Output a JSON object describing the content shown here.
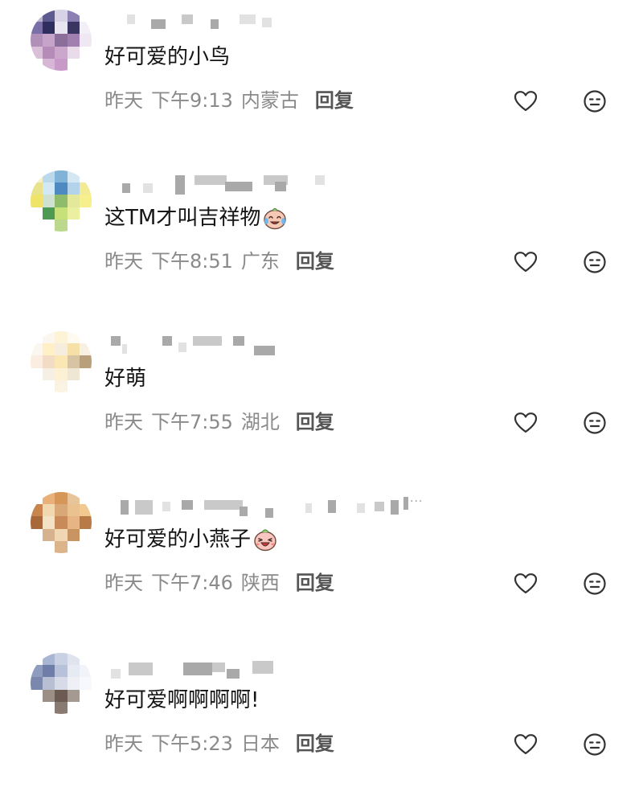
{
  "comments": [
    {
      "username_label": "",
      "text": "好可爱的小鸟",
      "date": "昨天",
      "time": "下午9:13",
      "location": "内蒙古",
      "reply_label": "回复",
      "emoji": ""
    },
    {
      "username_label": "",
      "text": "这TM才叫吉祥物",
      "date": "昨天",
      "time": "下午8:51",
      "location": "广东",
      "reply_label": "回复",
      "emoji": "crying-laughing-face"
    },
    {
      "username_label": "",
      "text": "好萌",
      "date": "昨天",
      "time": "下午7:55",
      "location": "湖北",
      "reply_label": "回复",
      "emoji": ""
    },
    {
      "username_label": "",
      "text": "好可爱的小燕子",
      "date": "昨天",
      "time": "下午7:46",
      "location": "陕西",
      "reply_label": "回复",
      "emoji": "laughing-face"
    },
    {
      "username_label": "",
      "text": "好可爱啊啊啊啊!",
      "date": "昨天",
      "time": "下午5:23",
      "location": "日本",
      "reply_label": "回复",
      "emoji": ""
    }
  ],
  "username_truncation": "...",
  "icons": {
    "like": "heart-outline-icon",
    "react": "emoji-face-icon"
  },
  "colors": {
    "text": "#151515",
    "meta": "#8a8a8a",
    "reply": "#555555",
    "icon": "#333333"
  }
}
